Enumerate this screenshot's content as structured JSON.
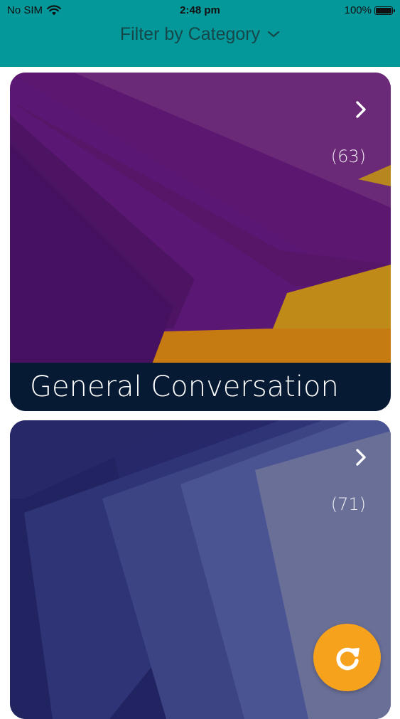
{
  "status_bar": {
    "carrier": "No SIM",
    "time": "2:48 pm",
    "battery": "100%"
  },
  "header": {
    "filter_label": "Filter by Category"
  },
  "categories": [
    {
      "title": "General Conversation",
      "count": "(63)"
    },
    {
      "title": "",
      "count": "(71)"
    }
  ],
  "colors": {
    "header_bg": "#05989b",
    "filter_text": "#15484a",
    "card_title_bg": "#071a33",
    "fab_bg": "#f6a21d"
  },
  "icons": {
    "wifi": "wifi-icon",
    "battery": "battery-icon",
    "filter_chevron": "chevron-down-icon",
    "card_chevron": "chevron-right-icon",
    "refresh": "refresh-icon"
  }
}
